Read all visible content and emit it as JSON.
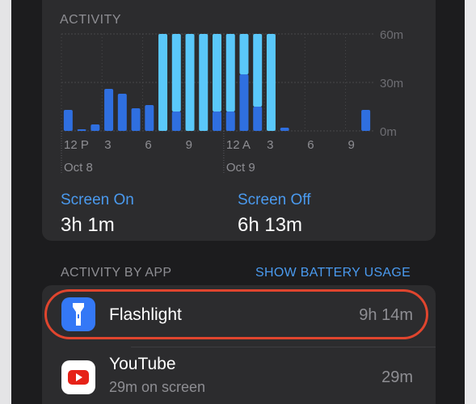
{
  "activity": {
    "title": "ACTIVITY",
    "y_ticks": [
      "60m",
      "30m",
      "0m"
    ],
    "x_ticks": [
      "12 P",
      "3",
      "6",
      "9",
      "12 A",
      "3",
      "6",
      "9"
    ],
    "dates": [
      "Oct 8",
      "Oct 9"
    ]
  },
  "chart_data": {
    "type": "bar",
    "title": "ACTIVITY",
    "y_unit": "minutes",
    "ylim": [
      0,
      60
    ],
    "grid": true,
    "series": [
      {
        "name": "",
        "color": "#2f6fe0",
        "values": [
          13,
          1,
          4,
          26,
          23,
          14,
          16,
          0,
          12,
          0,
          0,
          12,
          12,
          35,
          15,
          0,
          2,
          0,
          0,
          0,
          0,
          0,
          13
        ]
      },
      {
        "name": "",
        "color": "#5ac8fa",
        "values": [
          0,
          0,
          0,
          0,
          0,
          0,
          0,
          60,
          48,
          60,
          60,
          48,
          48,
          25,
          45,
          60,
          0,
          0,
          0,
          0,
          0,
          0,
          0
        ]
      }
    ]
  },
  "summary": {
    "screen_on_label": "Screen On",
    "screen_on_value": "3h 1m",
    "screen_off_label": "Screen Off",
    "screen_off_value": "6h 13m"
  },
  "by_app": {
    "header": "ACTIVITY BY APP",
    "battery_link": "SHOW BATTERY USAGE",
    "apps": [
      {
        "name": "Flashlight",
        "time": "9h 14m",
        "icon": "flashlight-icon"
      },
      {
        "name": "YouTube",
        "sub": "29m on screen",
        "time": "29m",
        "icon": "youtube-icon"
      }
    ]
  },
  "colors": {
    "accent_blue": "#4a9aef",
    "bar_dark": "#2f6fe0",
    "bar_light": "#5ac8fa",
    "highlight": "#e0452e"
  }
}
